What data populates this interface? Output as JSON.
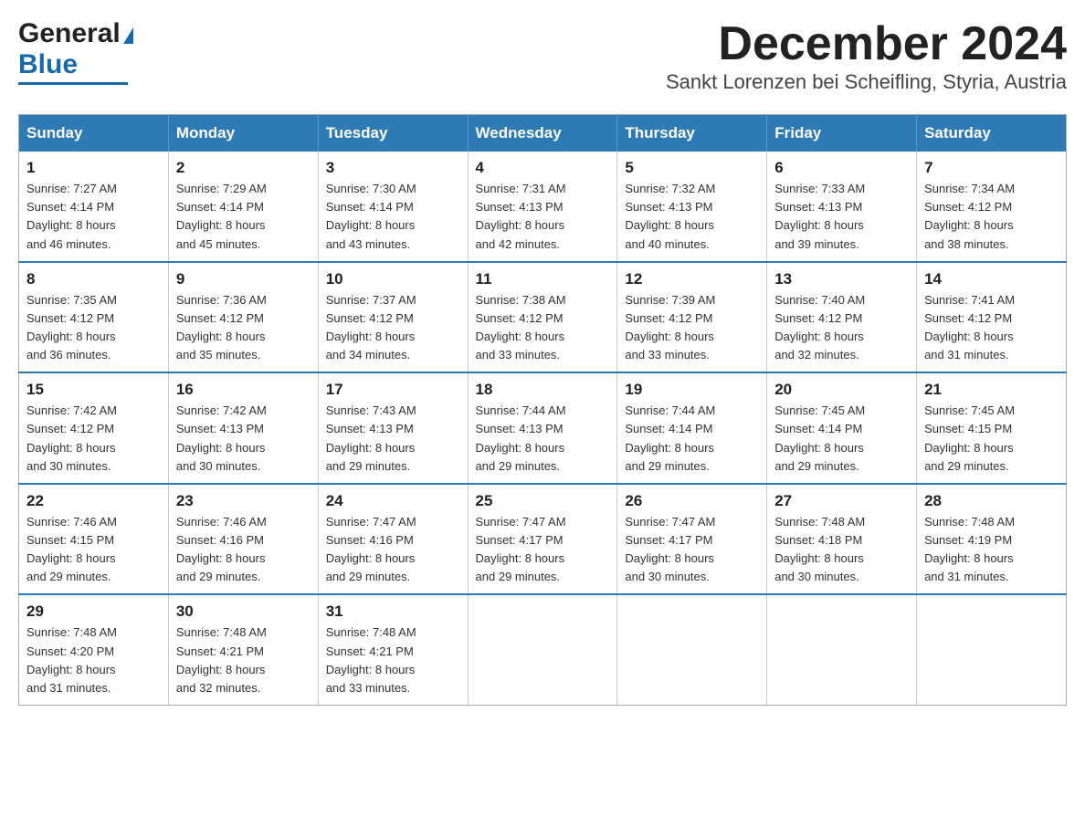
{
  "logo": {
    "general": "General",
    "blue": "Blue"
  },
  "title": "December 2024",
  "subtitle": "Sankt Lorenzen bei Scheifling, Styria, Austria",
  "days_of_week": [
    "Sunday",
    "Monday",
    "Tuesday",
    "Wednesday",
    "Thursday",
    "Friday",
    "Saturday"
  ],
  "weeks": [
    [
      {
        "day": "1",
        "sunrise": "7:27 AM",
        "sunset": "4:14 PM",
        "daylight": "8 hours and 46 minutes."
      },
      {
        "day": "2",
        "sunrise": "7:29 AM",
        "sunset": "4:14 PM",
        "daylight": "8 hours and 45 minutes."
      },
      {
        "day": "3",
        "sunrise": "7:30 AM",
        "sunset": "4:14 PM",
        "daylight": "8 hours and 43 minutes."
      },
      {
        "day": "4",
        "sunrise": "7:31 AM",
        "sunset": "4:13 PM",
        "daylight": "8 hours and 42 minutes."
      },
      {
        "day": "5",
        "sunrise": "7:32 AM",
        "sunset": "4:13 PM",
        "daylight": "8 hours and 40 minutes."
      },
      {
        "day": "6",
        "sunrise": "7:33 AM",
        "sunset": "4:13 PM",
        "daylight": "8 hours and 39 minutes."
      },
      {
        "day": "7",
        "sunrise": "7:34 AM",
        "sunset": "4:12 PM",
        "daylight": "8 hours and 38 minutes."
      }
    ],
    [
      {
        "day": "8",
        "sunrise": "7:35 AM",
        "sunset": "4:12 PM",
        "daylight": "8 hours and 36 minutes."
      },
      {
        "day": "9",
        "sunrise": "7:36 AM",
        "sunset": "4:12 PM",
        "daylight": "8 hours and 35 minutes."
      },
      {
        "day": "10",
        "sunrise": "7:37 AM",
        "sunset": "4:12 PM",
        "daylight": "8 hours and 34 minutes."
      },
      {
        "day": "11",
        "sunrise": "7:38 AM",
        "sunset": "4:12 PM",
        "daylight": "8 hours and 33 minutes."
      },
      {
        "day": "12",
        "sunrise": "7:39 AM",
        "sunset": "4:12 PM",
        "daylight": "8 hours and 33 minutes."
      },
      {
        "day": "13",
        "sunrise": "7:40 AM",
        "sunset": "4:12 PM",
        "daylight": "8 hours and 32 minutes."
      },
      {
        "day": "14",
        "sunrise": "7:41 AM",
        "sunset": "4:12 PM",
        "daylight": "8 hours and 31 minutes."
      }
    ],
    [
      {
        "day": "15",
        "sunrise": "7:42 AM",
        "sunset": "4:12 PM",
        "daylight": "8 hours and 30 minutes."
      },
      {
        "day": "16",
        "sunrise": "7:42 AM",
        "sunset": "4:13 PM",
        "daylight": "8 hours and 30 minutes."
      },
      {
        "day": "17",
        "sunrise": "7:43 AM",
        "sunset": "4:13 PM",
        "daylight": "8 hours and 29 minutes."
      },
      {
        "day": "18",
        "sunrise": "7:44 AM",
        "sunset": "4:13 PM",
        "daylight": "8 hours and 29 minutes."
      },
      {
        "day": "19",
        "sunrise": "7:44 AM",
        "sunset": "4:14 PM",
        "daylight": "8 hours and 29 minutes."
      },
      {
        "day": "20",
        "sunrise": "7:45 AM",
        "sunset": "4:14 PM",
        "daylight": "8 hours and 29 minutes."
      },
      {
        "day": "21",
        "sunrise": "7:45 AM",
        "sunset": "4:15 PM",
        "daylight": "8 hours and 29 minutes."
      }
    ],
    [
      {
        "day": "22",
        "sunrise": "7:46 AM",
        "sunset": "4:15 PM",
        "daylight": "8 hours and 29 minutes."
      },
      {
        "day": "23",
        "sunrise": "7:46 AM",
        "sunset": "4:16 PM",
        "daylight": "8 hours and 29 minutes."
      },
      {
        "day": "24",
        "sunrise": "7:47 AM",
        "sunset": "4:16 PM",
        "daylight": "8 hours and 29 minutes."
      },
      {
        "day": "25",
        "sunrise": "7:47 AM",
        "sunset": "4:17 PM",
        "daylight": "8 hours and 29 minutes."
      },
      {
        "day": "26",
        "sunrise": "7:47 AM",
        "sunset": "4:17 PM",
        "daylight": "8 hours and 30 minutes."
      },
      {
        "day": "27",
        "sunrise": "7:48 AM",
        "sunset": "4:18 PM",
        "daylight": "8 hours and 30 minutes."
      },
      {
        "day": "28",
        "sunrise": "7:48 AM",
        "sunset": "4:19 PM",
        "daylight": "8 hours and 31 minutes."
      }
    ],
    [
      {
        "day": "29",
        "sunrise": "7:48 AM",
        "sunset": "4:20 PM",
        "daylight": "8 hours and 31 minutes."
      },
      {
        "day": "30",
        "sunrise": "7:48 AM",
        "sunset": "4:21 PM",
        "daylight": "8 hours and 32 minutes."
      },
      {
        "day": "31",
        "sunrise": "7:48 AM",
        "sunset": "4:21 PM",
        "daylight": "8 hours and 33 minutes."
      },
      null,
      null,
      null,
      null
    ]
  ],
  "labels": {
    "sunrise": "Sunrise:",
    "sunset": "Sunset:",
    "daylight": "Daylight:"
  }
}
